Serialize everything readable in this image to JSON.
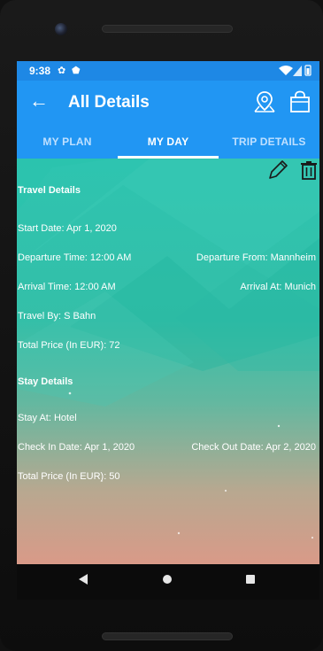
{
  "status": {
    "time": "9:38"
  },
  "appbar": {
    "title": "All Details"
  },
  "tabs": [
    {
      "label": "MY PLAN",
      "active": false
    },
    {
      "label": "MY DAY",
      "active": true
    },
    {
      "label": "TRIP DETAILS",
      "active": false
    }
  ],
  "travel": {
    "heading": "Travel Details",
    "start_date": "Start Date:  Apr 1, 2020",
    "departure_time": "Departure Time:  12:00 AM",
    "departure_from": "Departure From:  Mannheim",
    "arrival_time": "Arrival Time:  12:00 AM",
    "arrival_at": "Arrival At:  Munich",
    "travel_by": "Travel By:  S Bahn",
    "total_price": "Total Price (In EUR):  72"
  },
  "stay": {
    "heading": "Stay Details",
    "stay_at": "Stay At:  Hotel",
    "check_in": "Check In Date:  Apr 1, 2020",
    "check_out": "Check Out Date:  Apr 2, 2020",
    "total_price": "Total Price (In EUR):  50"
  },
  "icons": {
    "back": "arrow-left-icon",
    "map": "map-pin-icon",
    "bag": "shopping-bag-icon",
    "edit": "pencil-icon",
    "delete": "trash-icon"
  },
  "colors": {
    "primary": "#2196f3",
    "status_bar": "#1e88e5",
    "content_top": "#2ec4b0",
    "content_bottom": "#d99a88"
  }
}
